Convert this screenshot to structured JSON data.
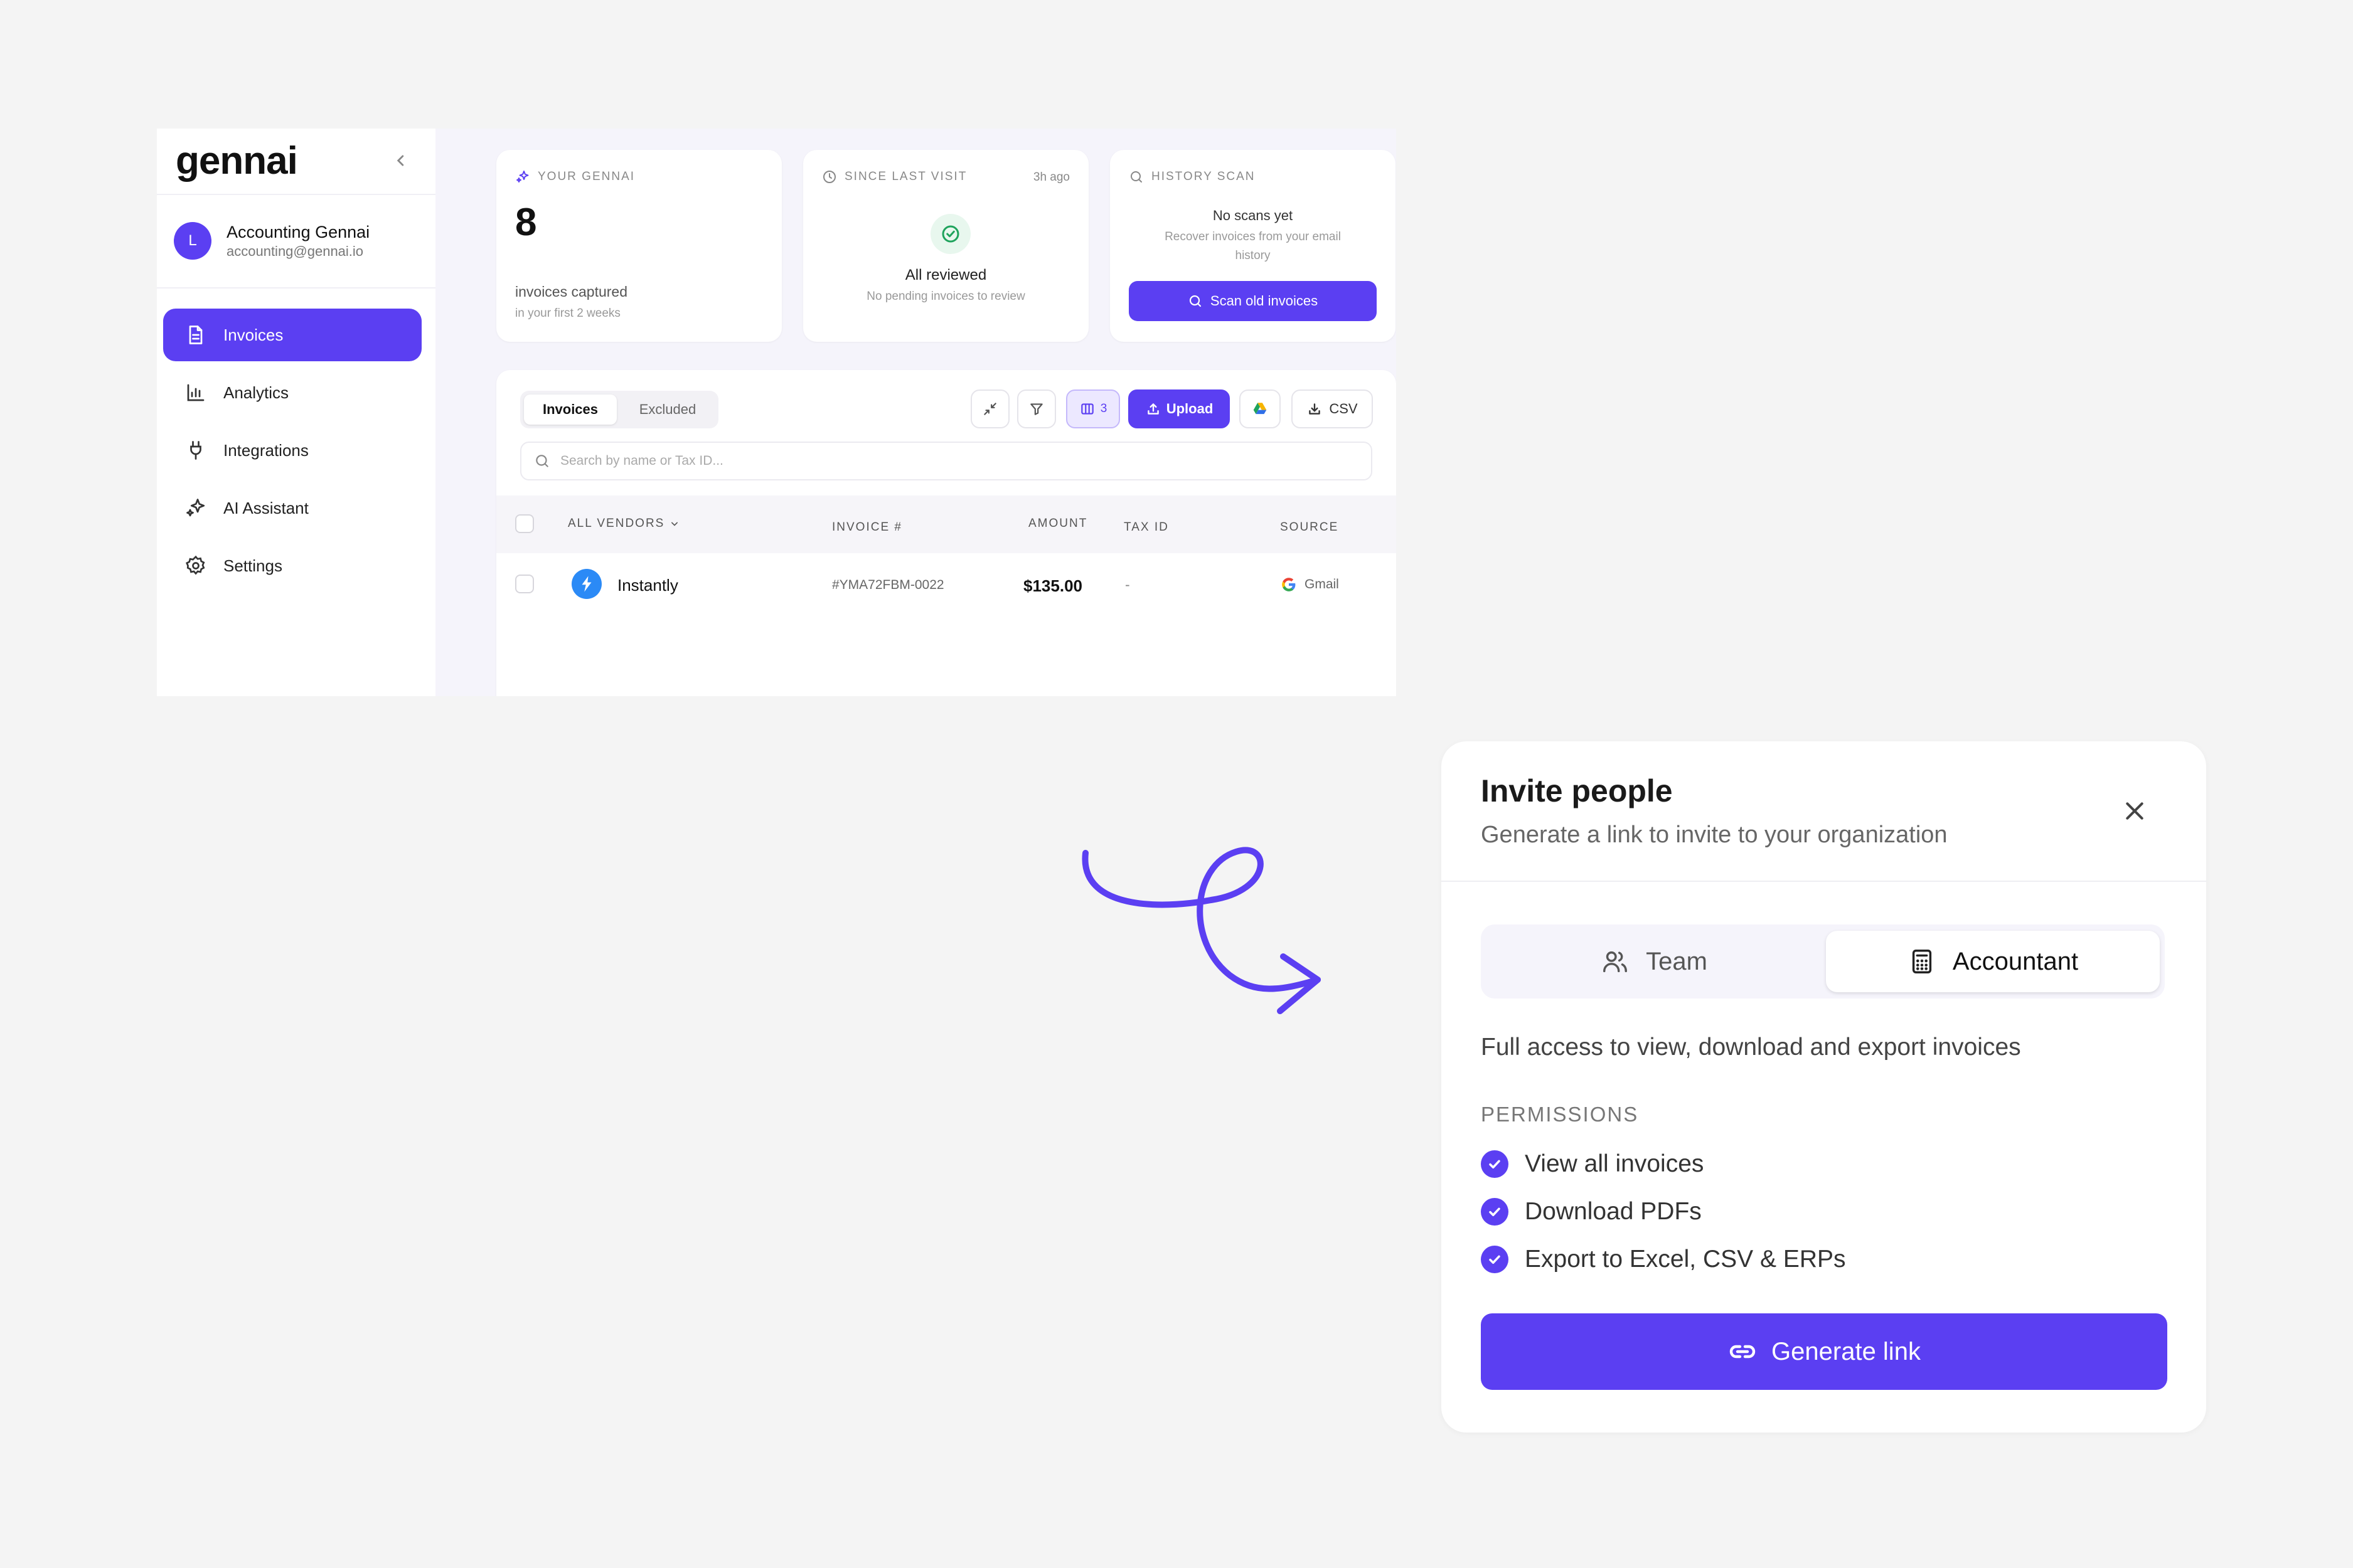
{
  "sidebar": {
    "brand": "gennai",
    "user": {
      "initial": "L",
      "name": "Accounting Gennai",
      "email": "accounting@gennai.io"
    },
    "items": [
      {
        "label": "Invoices",
        "icon": "document-icon",
        "active": true
      },
      {
        "label": "Analytics",
        "icon": "bar-chart-icon",
        "active": false
      },
      {
        "label": "Integrations",
        "icon": "plug-icon",
        "active": false
      },
      {
        "label": "AI Assistant",
        "icon": "sparkles-icon",
        "active": false
      },
      {
        "label": "Settings",
        "icon": "gear-icon",
        "active": false
      }
    ]
  },
  "stats": {
    "your_gennai": {
      "title": "YOUR GENNAI",
      "count": "8",
      "line1": "invoices captured",
      "line2": "in your first 2 weeks"
    },
    "since_last_visit": {
      "title": "SINCE LAST VISIT",
      "ago": "3h ago",
      "status": "All reviewed",
      "detail": "No pending invoices to review"
    },
    "history_scan": {
      "title": "HISTORY SCAN",
      "status": "No scans yet",
      "detail_line1": "Recover invoices from your email",
      "detail_line2": "history",
      "button": "Scan old invoices"
    }
  },
  "invoices": {
    "tabs": [
      "Invoices",
      "Excluded"
    ],
    "columns_count": "3",
    "upload_label": "Upload",
    "csv_label": "CSV",
    "search_placeholder": "Search by name or Tax ID...",
    "headers": {
      "vendor": "ALL VENDORS",
      "invoice": "INVOICE #",
      "amount": "AMOUNT",
      "tax": "TAX ID",
      "source": "SOURCE"
    },
    "rows": [
      {
        "vendor": "Instantly",
        "invoice": "#YMA72FBM-0022",
        "amount": "$135.00",
        "tax": "-",
        "source": "Gmail"
      }
    ]
  },
  "modal": {
    "title": "Invite people",
    "subtitle": "Generate a link to invite to your organization",
    "tabs": [
      {
        "label": "Team",
        "icon": "users-icon",
        "active": false
      },
      {
        "label": "Accountant",
        "icon": "calculator-icon",
        "active": true
      }
    ],
    "description": "Full access to view, download and export invoices",
    "permissions_title": "PERMISSIONS",
    "permissions": [
      "View all invoices",
      "Download PDFs",
      "Export to Excel, CSV & ERPs"
    ],
    "button": "Generate link"
  },
  "colors": {
    "accent": "#5b3ff2",
    "success": "#1fa35c",
    "background": "#f4f4f4"
  }
}
